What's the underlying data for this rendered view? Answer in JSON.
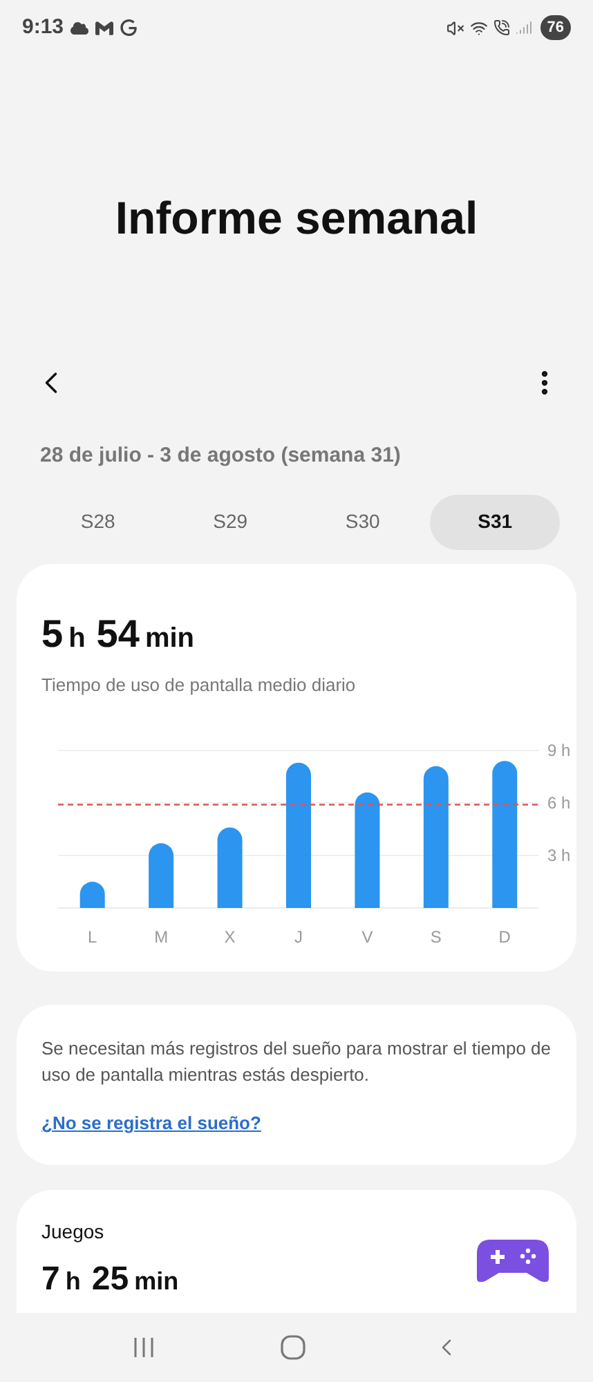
{
  "status_bar": {
    "time": "9:13",
    "battery": "76"
  },
  "header": {
    "title": "Informe semanal"
  },
  "week_range": "28 de julio - 3 de agosto (semana 31)",
  "tabs": [
    {
      "label": "S28",
      "selected": false
    },
    {
      "label": "S29",
      "selected": false
    },
    {
      "label": "S30",
      "selected": false
    },
    {
      "label": "S31",
      "selected": true
    }
  ],
  "summary": {
    "hours": "5",
    "hours_unit": "h",
    "minutes": "54",
    "minutes_unit": "min",
    "caption": "Tiempo de uso de pantalla medio diario",
    "chart_data": {
      "type": "bar",
      "categories": [
        "L",
        "M",
        "X",
        "J",
        "V",
        "S",
        "D"
      ],
      "series": [
        {
          "color": "#2b95ef",
          "values": [
            1.5,
            3.7,
            4.6,
            8.3,
            6.6,
            8.1,
            8.4
          ]
        }
      ],
      "ylim": [
        0,
        9
      ],
      "yticks": [
        {
          "value": 3,
          "label": "3 h"
        },
        {
          "value": 6,
          "label": "6 h"
        },
        {
          "value": 9,
          "label": "9 h"
        }
      ],
      "ref_lines": [
        {
          "axis": "y",
          "value": 5.9,
          "color": "#d9575c"
        }
      ]
    }
  },
  "sleep_notice": {
    "text": "Se necesitan más registros del sueño para mostrar el tiempo de uso de pantalla mientras estás despierto.",
    "link": "¿No se registra el sueño?"
  },
  "category": {
    "name": "Juegos",
    "hours": "7",
    "hours_unit": "h",
    "minutes": "25",
    "minutes_unit": "min"
  }
}
